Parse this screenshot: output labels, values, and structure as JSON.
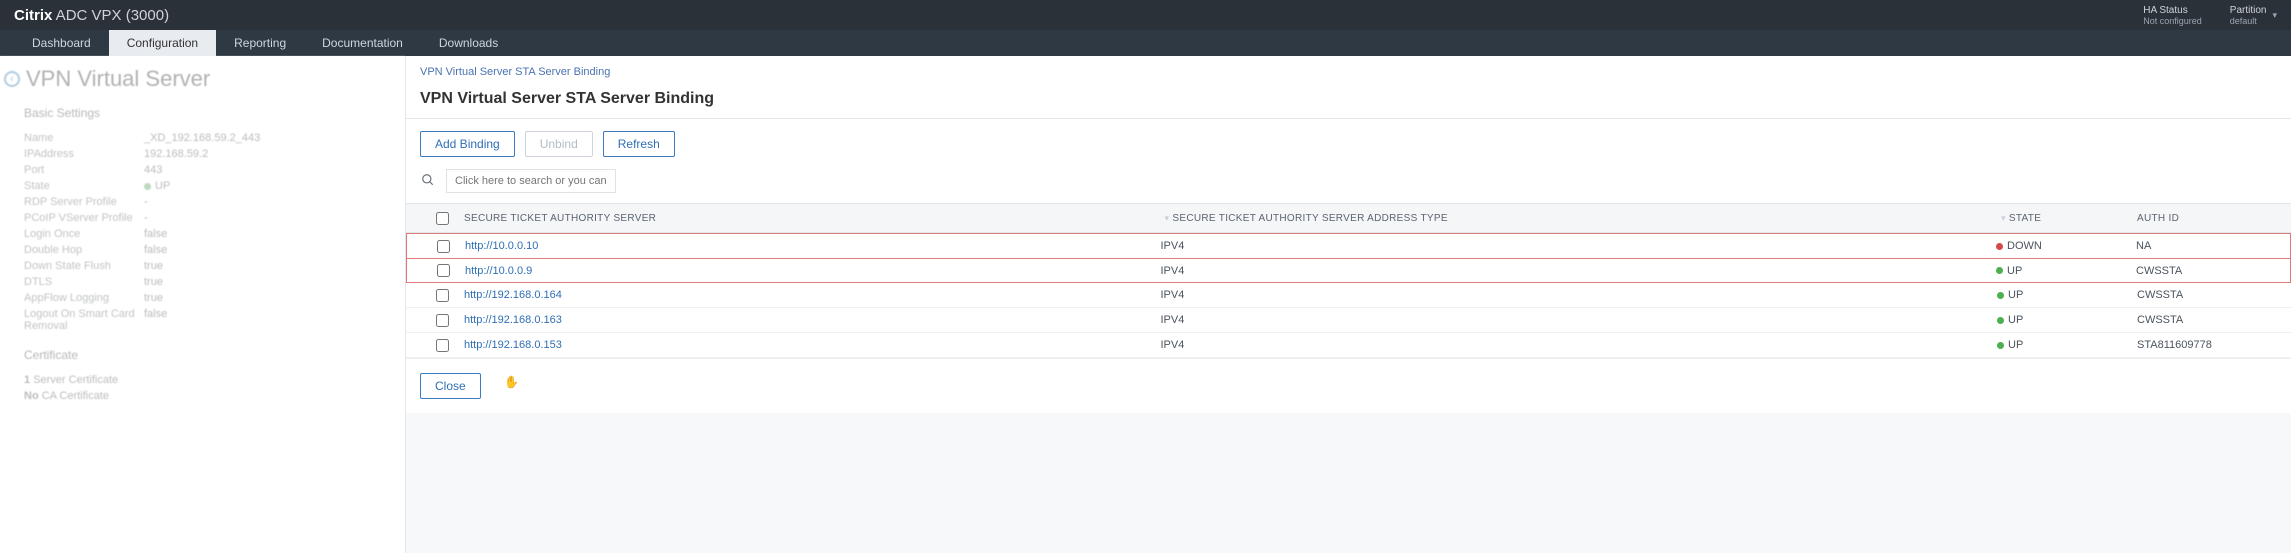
{
  "topbar": {
    "brand_strong": "Citrix",
    "brand_light": " ADC VPX (3000)",
    "ha_label": "HA Status",
    "ha_value": "Not configured",
    "partition_label": "Partition",
    "partition_value": "default"
  },
  "nav": {
    "items": [
      "Dashboard",
      "Configuration",
      "Reporting",
      "Documentation",
      "Downloads"
    ],
    "active_index": 1
  },
  "left": {
    "page_title": "VPN Virtual Server",
    "basic_settings_hdr": "Basic Settings",
    "fields": [
      {
        "k": "Name",
        "v": "_XD_192.168.59.2_443"
      },
      {
        "k": "IPAddress",
        "v": "192.168.59.2"
      },
      {
        "k": "Port",
        "v": "443"
      },
      {
        "k": "State",
        "v": "UP",
        "state": "green"
      },
      {
        "k": "RDP Server Profile",
        "v": "-"
      },
      {
        "k": "PCoIP VServer Profile",
        "v": "-"
      },
      {
        "k": "Login Once",
        "v": "false"
      },
      {
        "k": "Double Hop",
        "v": "false"
      },
      {
        "k": "Down State Flush",
        "v": "true"
      },
      {
        "k": "DTLS",
        "v": "true"
      },
      {
        "k": "AppFlow Logging",
        "v": "true"
      },
      {
        "k": "Logout On Smart Card Removal",
        "v": "false"
      }
    ],
    "cert_hdr": "Certificate",
    "cert_line1_count": "1",
    "cert_line1_label": "Server Certificate",
    "cert_line2_no": "No",
    "cert_line2_label": "CA Certificate"
  },
  "dialog": {
    "breadcrumb": "VPN Virtual Server STA Server Binding",
    "title": "VPN Virtual Server STA Server Binding",
    "btn_add": "Add Binding",
    "btn_unbind": "Unbind",
    "btn_refresh": "Refresh",
    "search_placeholder": "Click here to search or you can ente",
    "columns": {
      "sta": "SECURE TICKET AUTHORITY SERVER",
      "type": "SECURE TICKET AUTHORITY SERVER ADDRESS TYPE",
      "state": "STATE",
      "auth": "AUTH ID"
    },
    "rows": [
      {
        "sta": "http://10.0.0.10",
        "type": "IPV4",
        "state": "DOWN",
        "state_color": "red",
        "auth": "NA",
        "hl": "top"
      },
      {
        "sta": "http://10.0.0.9",
        "type": "IPV4",
        "state": "UP",
        "state_color": "green",
        "auth": "CWSSTA",
        "hl": "bottom"
      },
      {
        "sta": "http://192.168.0.164",
        "type": "IPV4",
        "state": "UP",
        "state_color": "green",
        "auth": "CWSSTA"
      },
      {
        "sta": "http://192.168.0.163",
        "type": "IPV4",
        "state": "UP",
        "state_color": "green",
        "auth": "CWSSTA"
      },
      {
        "sta": "http://192.168.0.153",
        "type": "IPV4",
        "state": "UP",
        "state_color": "green",
        "auth": "STA811609778"
      }
    ],
    "btn_close": "Close"
  }
}
